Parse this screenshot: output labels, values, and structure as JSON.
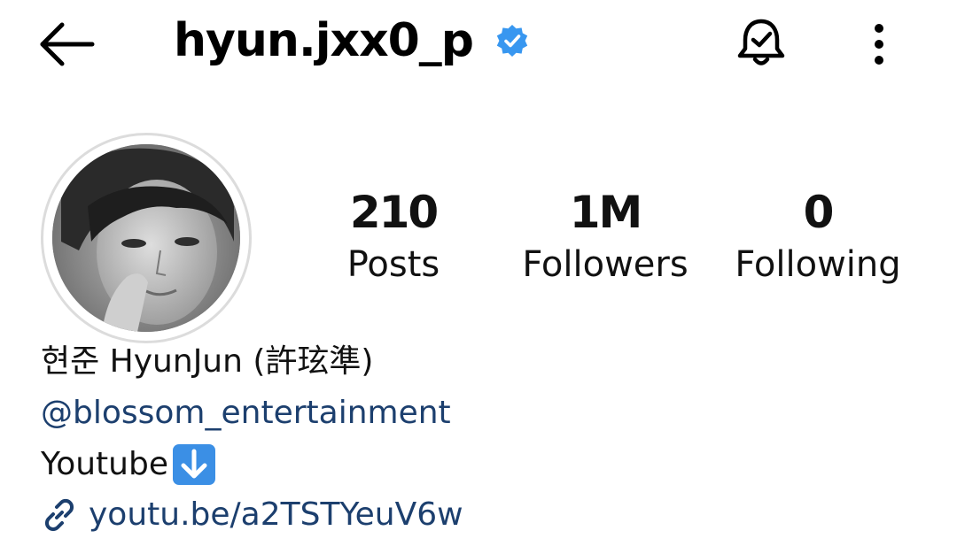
{
  "header": {
    "back_icon": "arrow-left-icon",
    "username": "hyun.jxx0_p",
    "verified_icon": "verified-badge-icon",
    "verified_color": "#3897f0",
    "notification_icon": "bell-check-icon",
    "more_icon": "more-vertical-icon"
  },
  "profile": {
    "avatar_alt": "profile picture",
    "stats": [
      {
        "value": "210",
        "label": "Posts"
      },
      {
        "value": "1M",
        "label": "Followers"
      },
      {
        "value": "0",
        "label": "Following"
      }
    ]
  },
  "bio": {
    "name": "현준 HyunJun (許玹準)",
    "mention": "@blossom_entertainment",
    "text": "Youtube",
    "emoji_icon": "down-arrow-emoji-icon",
    "link_icon": "link-icon",
    "link": "youtu.be/a2TSTYeuV6w",
    "link_color": "#1c3f6e"
  }
}
